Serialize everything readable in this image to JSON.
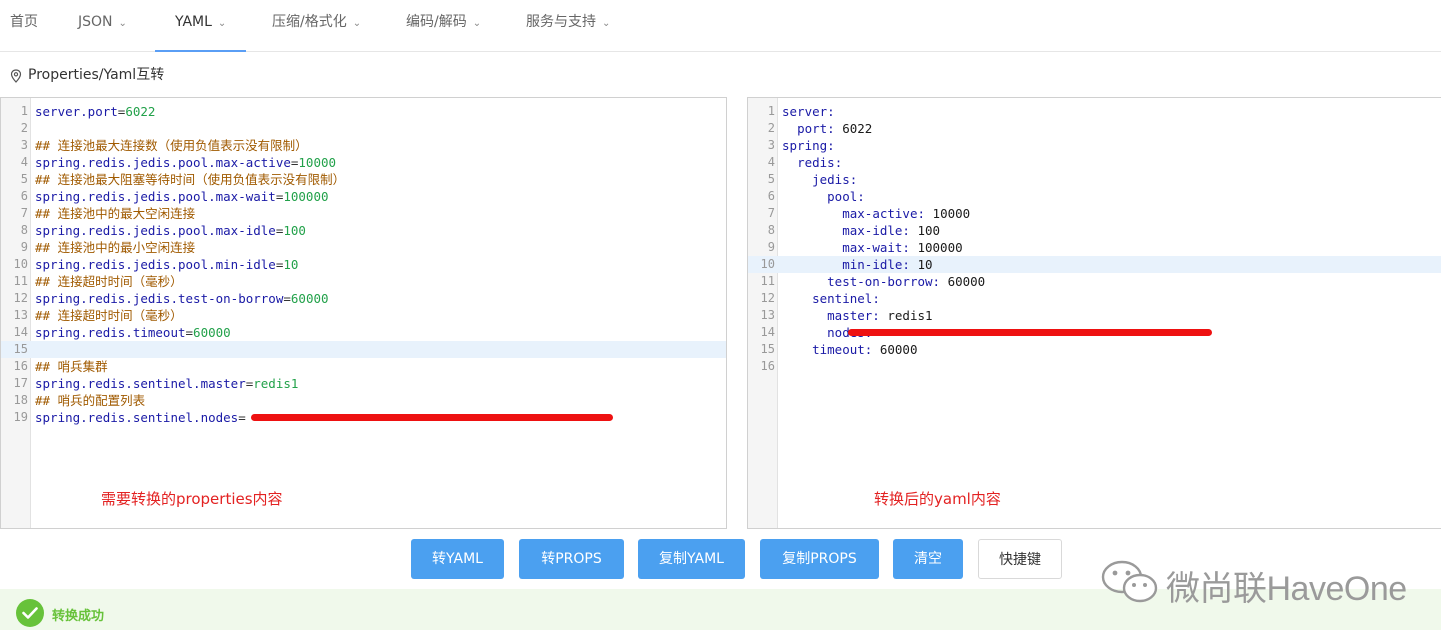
{
  "nav": {
    "items": [
      {
        "label": "首页",
        "dropdown": false,
        "active": false
      },
      {
        "label": "JSON",
        "dropdown": true,
        "active": false
      },
      {
        "label": "YAML",
        "dropdown": true,
        "active": true
      },
      {
        "label": "压缩/格式化",
        "dropdown": true,
        "active": false
      },
      {
        "label": "编码/解码",
        "dropdown": true,
        "active": false
      },
      {
        "label": "服务与支持",
        "dropdown": true,
        "active": false
      }
    ]
  },
  "breadcrumb": {
    "icon": "location-pin-icon",
    "text": "Properties/Yaml互转"
  },
  "left_editor": {
    "highlighted_line": 15,
    "lines": [
      {
        "n": "1",
        "key": "server.port",
        "eq": "=",
        "val": "6022",
        "comment": ""
      },
      {
        "n": "2",
        "key": "",
        "eq": "",
        "val": "",
        "comment": ""
      },
      {
        "n": "3",
        "key": "",
        "eq": "",
        "val": "",
        "comment": "## 连接池最大连接数（使用负值表示没有限制）"
      },
      {
        "n": "4",
        "key": "spring.redis.jedis.pool.max-active",
        "eq": "=",
        "val": "10000",
        "comment": ""
      },
      {
        "n": "5",
        "key": "",
        "eq": "",
        "val": "",
        "comment": "## 连接池最大阻塞等待时间（使用负值表示没有限制）"
      },
      {
        "n": "6",
        "key": "spring.redis.jedis.pool.max-wait",
        "eq": "=",
        "val": "100000",
        "comment": ""
      },
      {
        "n": "7",
        "key": "",
        "eq": "",
        "val": "",
        "comment": "## 连接池中的最大空闲连接"
      },
      {
        "n": "8",
        "key": "spring.redis.jedis.pool.max-idle",
        "eq": "=",
        "val": "100",
        "comment": ""
      },
      {
        "n": "9",
        "key": "",
        "eq": "",
        "val": "",
        "comment": "## 连接池中的最小空闲连接"
      },
      {
        "n": "10",
        "key": "spring.redis.jedis.pool.min-idle",
        "eq": "=",
        "val": "10",
        "comment": ""
      },
      {
        "n": "11",
        "key": "",
        "eq": "",
        "val": "",
        "comment": "## 连接超时时间（毫秒）"
      },
      {
        "n": "12",
        "key": "spring.redis.jedis.test-on-borrow",
        "eq": "=",
        "val": "60000",
        "comment": ""
      },
      {
        "n": "13",
        "key": "",
        "eq": "",
        "val": "",
        "comment": "## 连接超时时间（毫秒）"
      },
      {
        "n": "14",
        "key": "spring.redis.timeout",
        "eq": "=",
        "val": "60000",
        "comment": ""
      },
      {
        "n": "15",
        "key": "",
        "eq": "",
        "val": "",
        "comment": ""
      },
      {
        "n": "16",
        "key": "",
        "eq": "",
        "val": "",
        "comment": "## 哨兵集群"
      },
      {
        "n": "17",
        "key": "spring.redis.sentinel.master",
        "eq": "=",
        "val": "redis1",
        "comment": ""
      },
      {
        "n": "18",
        "key": "",
        "eq": "",
        "val": "",
        "comment": "## 哨兵的配置列表"
      },
      {
        "n": "19",
        "key": "spring.redis.sentinel.nodes",
        "eq": "=",
        "val": "",
        "comment": "",
        "redacted": true
      }
    ],
    "note": "需要转换的properties内容"
  },
  "right_editor": {
    "highlighted_line": 10,
    "lines": [
      {
        "n": "1",
        "indent": "",
        "key": "server:",
        "val": ""
      },
      {
        "n": "2",
        "indent": "  ",
        "key": "port:",
        "val": " 6022"
      },
      {
        "n": "3",
        "indent": "",
        "key": "spring:",
        "val": ""
      },
      {
        "n": "4",
        "indent": "  ",
        "key": "redis:",
        "val": ""
      },
      {
        "n": "5",
        "indent": "    ",
        "key": "jedis:",
        "val": ""
      },
      {
        "n": "6",
        "indent": "      ",
        "key": "pool:",
        "val": ""
      },
      {
        "n": "7",
        "indent": "        ",
        "key": "max-active:",
        "val": " 10000"
      },
      {
        "n": "8",
        "indent": "        ",
        "key": "max-idle:",
        "val": " 100"
      },
      {
        "n": "9",
        "indent": "        ",
        "key": "max-wait:",
        "val": " 100000"
      },
      {
        "n": "10",
        "indent": "        ",
        "key": "min-idle:",
        "val": " 10"
      },
      {
        "n": "11",
        "indent": "      ",
        "key": "test-on-borrow:",
        "val": " 60000"
      },
      {
        "n": "12",
        "indent": "    ",
        "key": "sentinel:",
        "val": ""
      },
      {
        "n": "13",
        "indent": "      ",
        "key": "master:",
        "val": " redis1"
      },
      {
        "n": "14",
        "indent": "      ",
        "key": "nodes:",
        "val": "",
        "redacted": true
      },
      {
        "n": "15",
        "indent": "    ",
        "key": "timeout:",
        "val": " 60000"
      },
      {
        "n": "16",
        "indent": "",
        "key": "",
        "val": ""
      }
    ],
    "note": "转换后的yaml内容"
  },
  "buttons": {
    "to_yaml": "转YAML",
    "to_props": "转PROPS",
    "copy_yaml": "复制YAML",
    "copy_props": "复制PROPS",
    "clear": "清空",
    "shortcuts": "快捷键"
  },
  "status": {
    "icon": "check-circle-icon",
    "message": "转换成功"
  },
  "watermark": {
    "icon": "wechat-icon",
    "text": "微尚联HaveOne"
  },
  "colors": {
    "primary": "#4ba0f0",
    "success": "#67c23a",
    "annotation_red": "#e32222",
    "redaction_red": "#ee1111"
  }
}
